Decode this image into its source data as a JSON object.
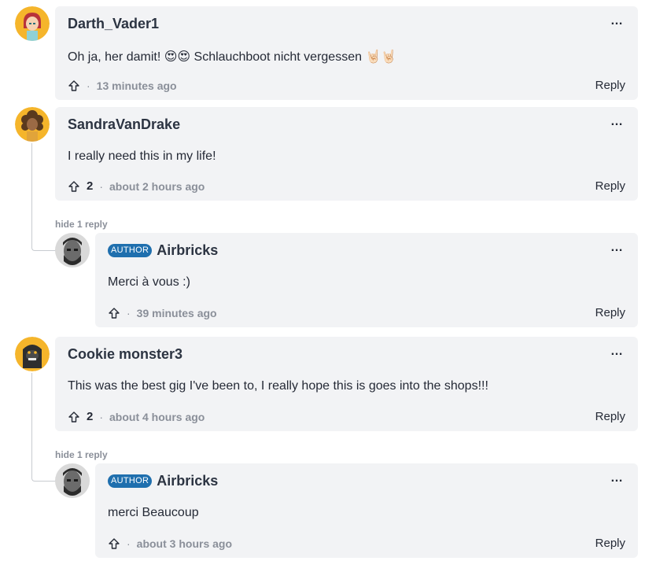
{
  "comments": [
    {
      "author": "Darth_Vader1",
      "text": "Oh ja, her damit! 😍😍 Schlauchboot nicht vergessen 🤘🏻🤘🏻",
      "upvotes": "",
      "time": "13 minutes ago",
      "reply": "Reply",
      "avatar_icon": "girl-avatar-icon"
    },
    {
      "author": "SandraVanDrake",
      "text": "I really need this in my life!",
      "upvotes": "2",
      "time": "about 2 hours ago",
      "reply": "Reply",
      "hide_label": "hide 1 reply",
      "avatar_icon": "curly-hair-avatar-icon",
      "replies": [
        {
          "badge": "AUTHOR",
          "author": "Airbricks",
          "text": "Merci à vous :)",
          "time": "39 minutes ago",
          "reply": "Reply",
          "avatar_icon": "bearded-man-photo-icon"
        }
      ]
    },
    {
      "author": "Cookie monster3",
      "text": "This was the best gig I've been to, I really hope this is goes into the shops!!!",
      "upvotes": "2",
      "time": "about 4 hours ago",
      "reply": "Reply",
      "hide_label": "hide 1 reply",
      "avatar_icon": "gorilla-avatar-icon",
      "replies": [
        {
          "badge": "AUTHOR",
          "author": "Airbricks",
          "text": "merci Beaucoup",
          "time": "about 3 hours ago",
          "reply": "Reply",
          "avatar_icon": "bearded-man-photo-icon"
        }
      ]
    }
  ],
  "more_icon": "…",
  "colors": {
    "card": "#f2f3f5",
    "author_badge": "#1f6fae",
    "avatar_bg": "#f5b52b"
  }
}
